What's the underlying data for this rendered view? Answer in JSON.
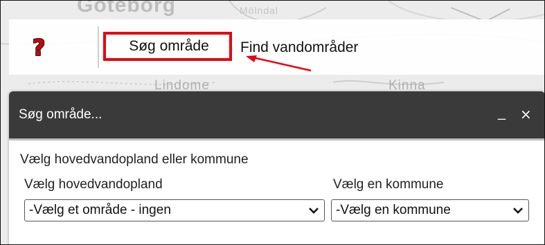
{
  "map": {
    "labels": [
      "Goteborg",
      "Lindome",
      "Kinna",
      "Mölndal"
    ]
  },
  "toolbar": {
    "help_icon": "question-mark-icon",
    "tabs": [
      {
        "label": "Søg område",
        "active": true
      },
      {
        "label": "Find vandområder",
        "active": false
      }
    ],
    "highlight_color": "#e8000f"
  },
  "dialog": {
    "title": "Søg område...",
    "minimize_label": "_",
    "close_label": "×",
    "description": "Vælg hovedvandopland eller kommune",
    "basin": {
      "label": "Vælg hovedvandopland",
      "selected": "-Vælg et område - ingen"
    },
    "municipality": {
      "label": "Vælg en kommune",
      "selected": "-Vælg en kommune"
    }
  },
  "colors": {
    "header_bg": "#3a3a3a",
    "accent_red": "#e8000f"
  }
}
